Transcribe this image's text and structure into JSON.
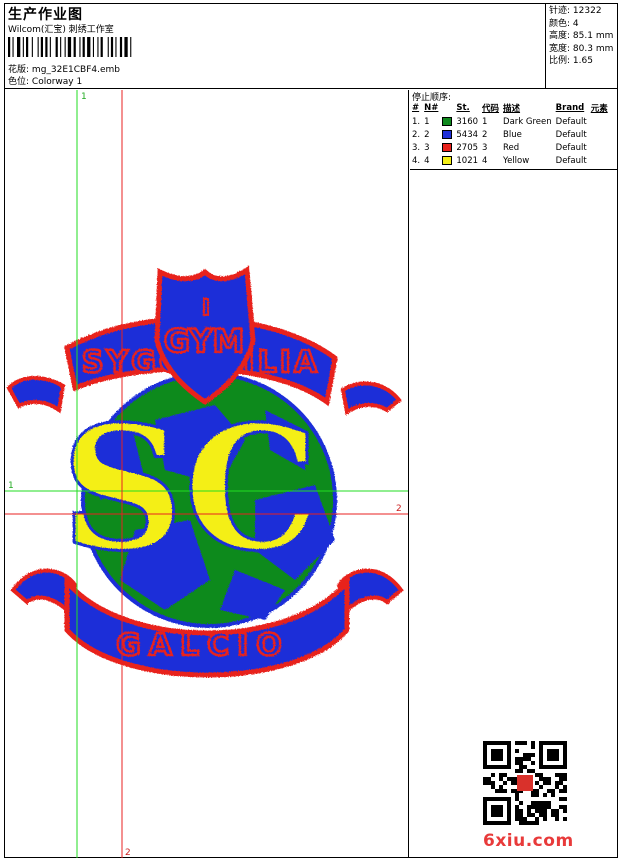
{
  "header": {
    "title": "生产作业图",
    "company": "Wilcom(汇宝) 刺绣工作室",
    "design_name_label": "花版:",
    "design_name": "mg_32E1CBF4.emb",
    "colorway_label": "色位:",
    "colorway": "Colorway 1"
  },
  "stats": [
    {
      "label": "针迹:",
      "value": "12322"
    },
    {
      "label": "颜色:",
      "value": "4"
    },
    {
      "label": "高度:",
      "value": "85.1 mm"
    },
    {
      "label": "宽度:",
      "value": "80.3 mm"
    },
    {
      "label": "比例:",
      "value": "1.65"
    }
  ],
  "stop_sequence": {
    "caption": "停止顺序:",
    "headers": [
      "#",
      "N#",
      "St.",
      "代码",
      "描述",
      "Brand",
      "元素"
    ],
    "rows": [
      {
        "n": "1.",
        "nn": "1",
        "color": "#0f8a1e",
        "st": "3160",
        "code": "1",
        "desc": "Dark Green",
        "brand": "Default"
      },
      {
        "n": "2.",
        "nn": "2",
        "color": "#1f2fd8",
        "st": "5434",
        "code": "2",
        "desc": "Blue",
        "brand": "Default"
      },
      {
        "n": "3.",
        "nn": "3",
        "color": "#e8221c",
        "st": "2705",
        "code": "3",
        "desc": "Red",
        "brand": "Default"
      },
      {
        "n": "4.",
        "nn": "4",
        "color": "#f4ef16",
        "st": "1021",
        "code": "4",
        "desc": "Yellow",
        "brand": "Default"
      }
    ]
  },
  "design": {
    "banner_top": "SYGGYMILIA",
    "crest_letters": "GYM",
    "ball_monogram": "SC",
    "banner_bottom": "GALCIO",
    "guide_labels": {
      "green_v": "1",
      "green_h": "1",
      "red_h": "2",
      "red_v": "2"
    }
  },
  "watermark": {
    "site": "6xiu.com"
  },
  "colors": {
    "green": "#0f8a1e",
    "blue": "#1f2fd8",
    "red": "#e8221c",
    "yellow": "#f4ef16",
    "guide_green": "#22dd22",
    "guide_red": "#e82020"
  }
}
